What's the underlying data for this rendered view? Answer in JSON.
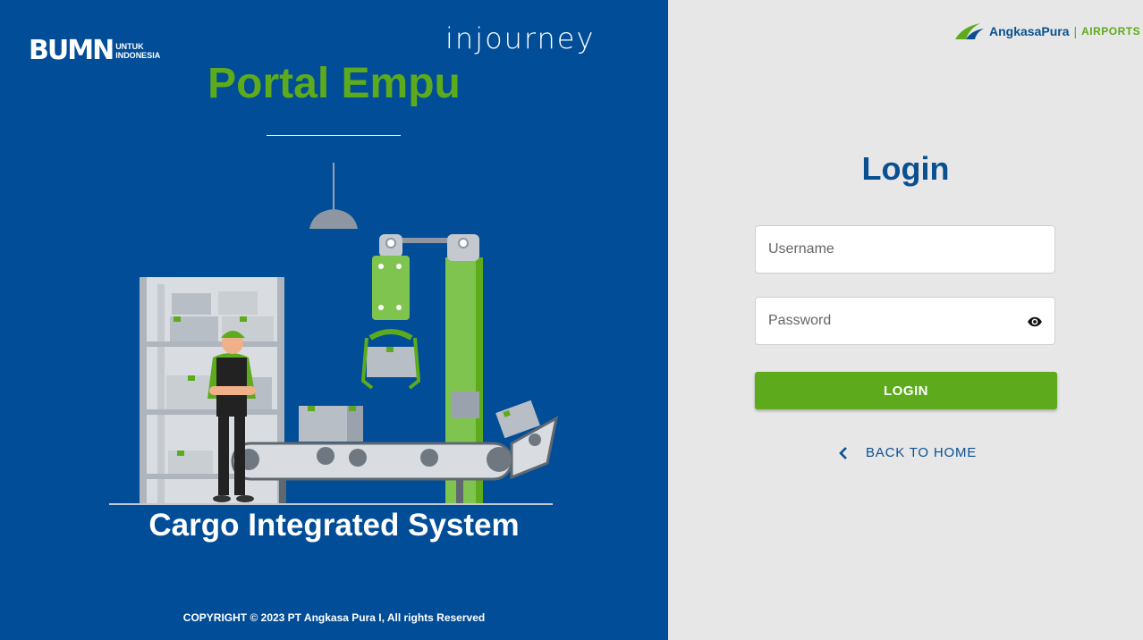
{
  "brand": {
    "bumn_big": "BUMN",
    "bumn_small_line1": "UNTUK",
    "bumn_small_line2": "INDONESIA",
    "injourney": "injourney",
    "ap_name": "AngkasaPura",
    "ap_sep": "|",
    "ap_airports": "AIRPORTS"
  },
  "hero": {
    "title": "Portal Empu",
    "subtitle": "Cargo Integrated System",
    "copyright": "COPYRIGHT © 2023 PT Angkasa Pura I, All rights Reserved"
  },
  "login": {
    "title": "Login",
    "username_placeholder": "Username",
    "password_placeholder": "Password",
    "button_label": "LOGIN",
    "back_label": "BACK TO HOME"
  },
  "colors": {
    "left_bg": "#014d97",
    "right_bg": "#e7e7e7",
    "accent_green": "#5dab1c",
    "brand_blue": "#0a5091"
  },
  "icons": {
    "password_toggle": "eye-icon",
    "back": "chevron-left-icon"
  }
}
